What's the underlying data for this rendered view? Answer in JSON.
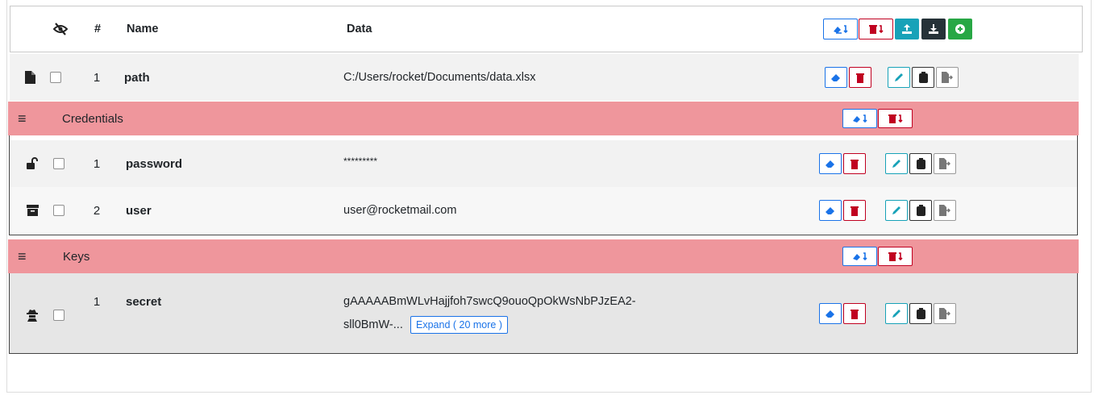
{
  "header": {
    "hash_label": "#",
    "name_label": "Name",
    "data_label": "Data"
  },
  "entries": [
    {
      "index": "1",
      "name": "path",
      "data": "C:/Users/rocket/Documents/data.xlsx"
    }
  ],
  "groups": [
    {
      "title": "Credentials",
      "menu_glyph": "≡",
      "entries": [
        {
          "index": "1",
          "name": "password",
          "data": "*********"
        },
        {
          "index": "2",
          "name": "user",
          "data": "user@rocketmail.com"
        }
      ]
    },
    {
      "title": "Keys",
      "menu_glyph": "≡",
      "entries": [
        {
          "index": "1",
          "name": "secret",
          "data_line1": "gAAAAABmWLvHajjfoh7swcQ9ouoQpOkWsNbPJzEA2-",
          "data_line2": "sll0BmW-...",
          "expand_label": "Expand ( 20 more )"
        }
      ]
    }
  ],
  "icons": {
    "visibility": "eye-slash-icon",
    "file": "file-icon",
    "unlock": "unlock-icon",
    "archive": "archive-icon",
    "secret": "user-secret-icon"
  },
  "colors": {
    "group_bar": "#ef969c",
    "blue": "#1a73e8",
    "red": "#c00020",
    "teal": "#17a2b8",
    "dark": "#263238",
    "green": "#28a745"
  }
}
